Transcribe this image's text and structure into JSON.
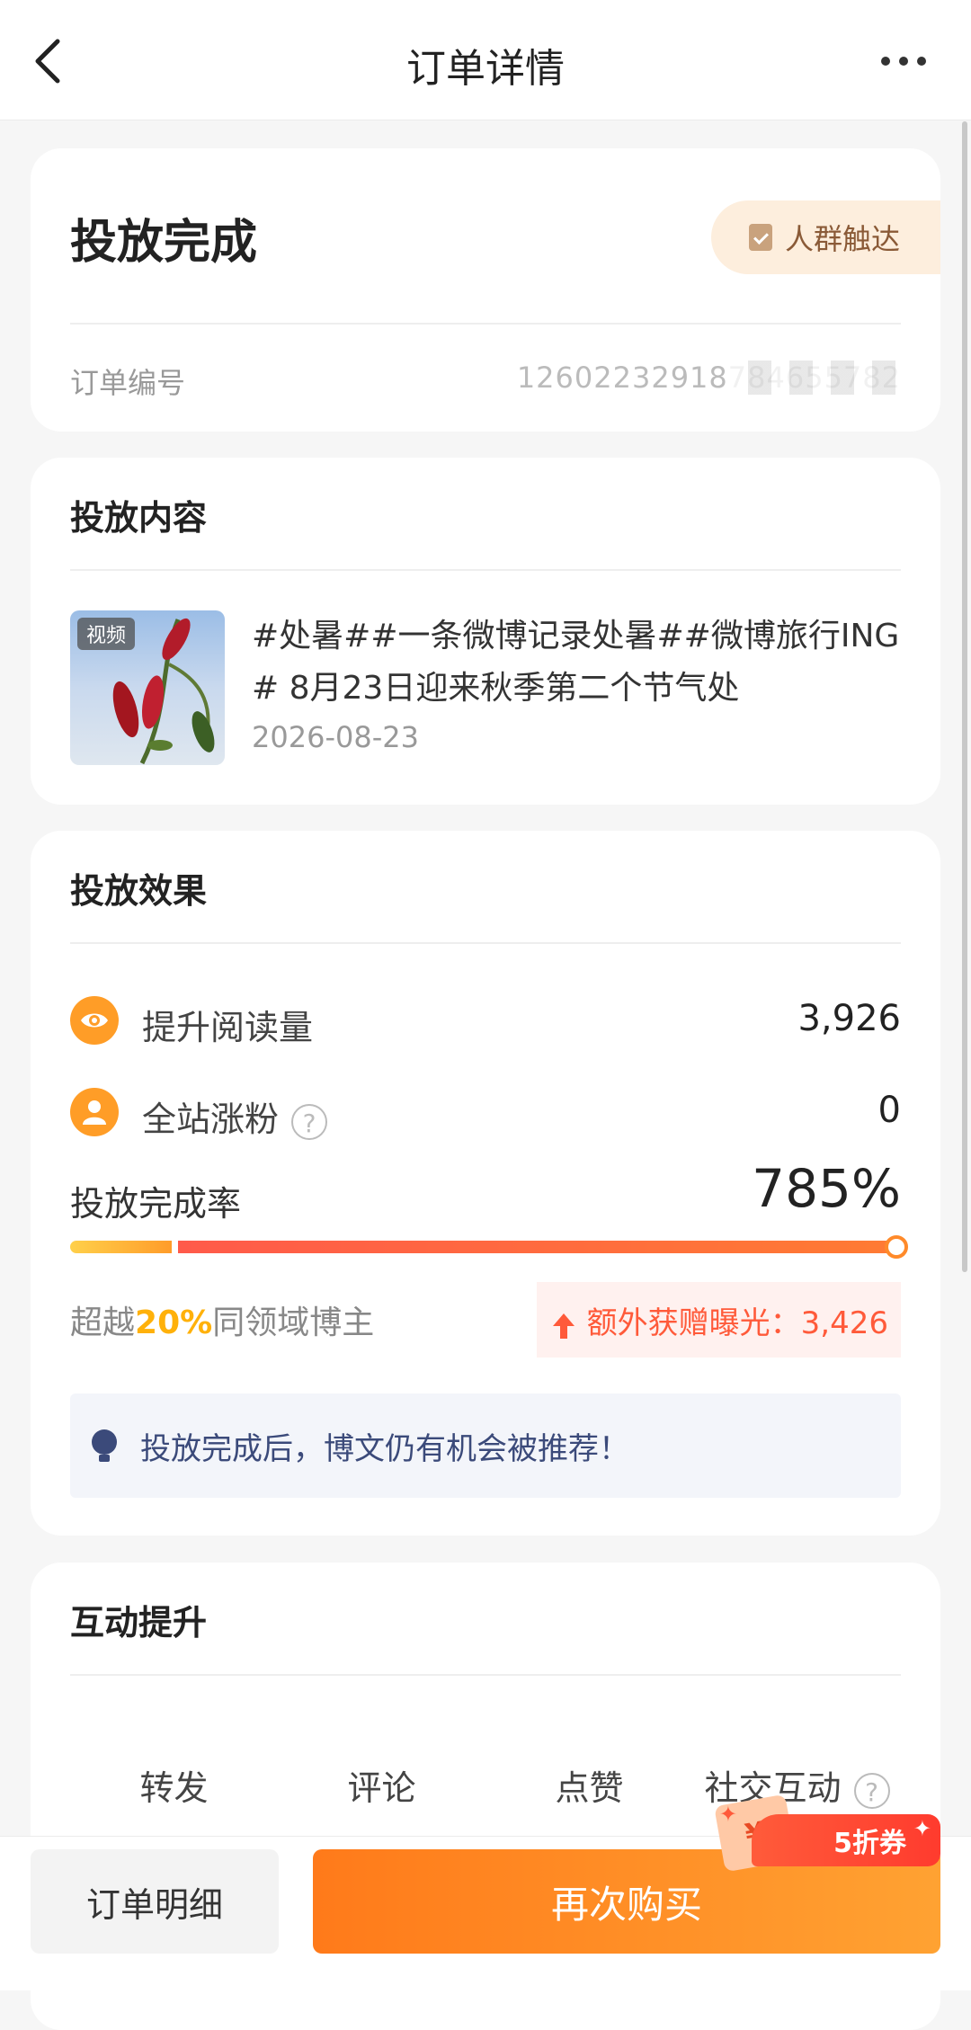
{
  "header": {
    "title": "订单详情"
  },
  "order": {
    "status": "投放完成",
    "tag": "人群触达",
    "number_label": "订单编号",
    "number_value": "12602232918784655782"
  },
  "content": {
    "title": "投放内容",
    "badge": "视频",
    "text": "#处暑##一条微博记录处暑##微博旅行ING# 8月23日迎来秋季第二个节气处",
    "date": "2026-08-23"
  },
  "effect": {
    "title": "投放效果",
    "read_label": "提升阅读量",
    "read_value": "3,926",
    "fans_label": "全站涨粉",
    "fans_value": "0",
    "rate_label": "投放完成率",
    "rate_value": "785%",
    "exceed_prefix": "超越",
    "exceed_pct": "20%",
    "exceed_suffix": "同领域博主",
    "bonus_text": "额外获赠曝光：3,426",
    "tip": "投放完成后，博文仍有机会被推荐！"
  },
  "interaction": {
    "title": "互动提升",
    "stats": [
      "转发",
      "评论",
      "点赞",
      "社交互动"
    ]
  },
  "bottom": {
    "detail_label": "订单明细",
    "buy_label": "再次购买",
    "coupon_label": "5折券",
    "coupon_icon": "¥"
  },
  "colors": {
    "accent": "#ff8a1c",
    "bonus": "#ff5a3a",
    "tip_text": "#3b4a7a"
  }
}
